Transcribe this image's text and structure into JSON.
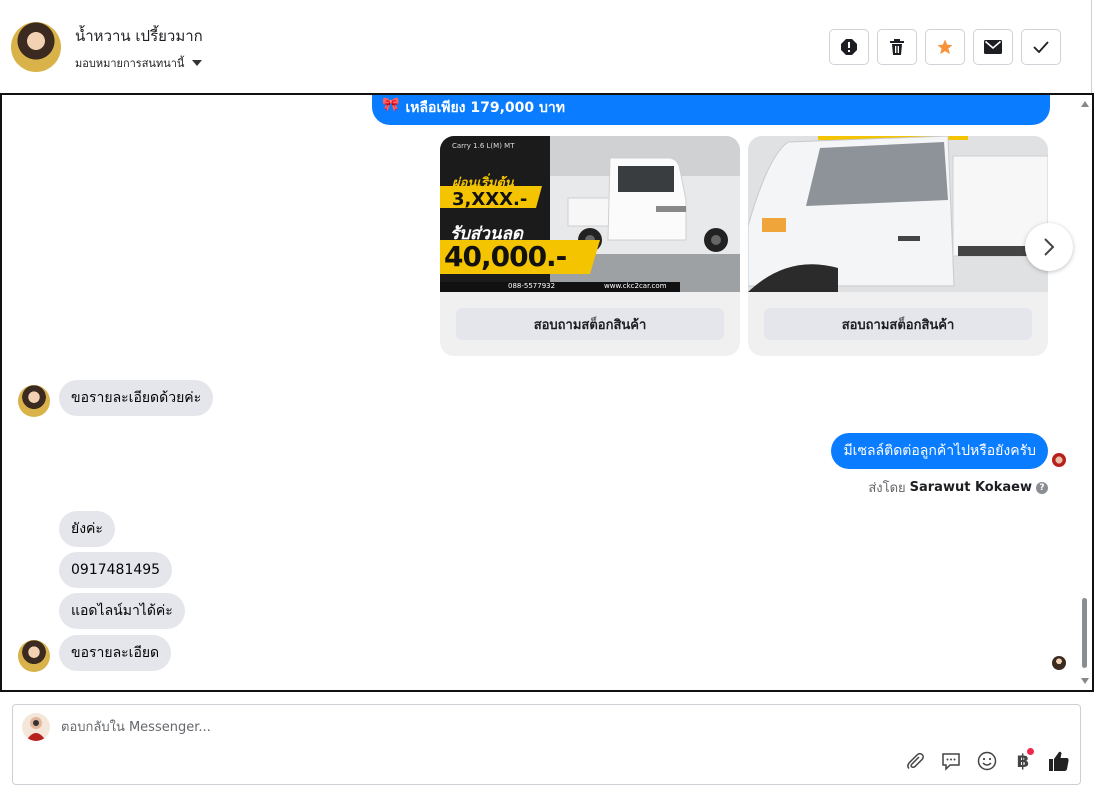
{
  "header": {
    "contact_name": "น้ำหวาน เปรี้ยวมาก",
    "assign_label": "มอบหมายการสนทนานี้",
    "actions": [
      {
        "name": "spam-icon"
      },
      {
        "name": "trash-icon"
      },
      {
        "name": "star-icon"
      },
      {
        "name": "mail-icon"
      },
      {
        "name": "check-icon"
      }
    ]
  },
  "promo": {
    "icon": "🎀",
    "text": "เหลือเพียง 179,000 บาท"
  },
  "cards": [
    {
      "button_label": "สอบถามสต็อกสินค้า",
      "overlay": {
        "line1": "ผ่อนเริ่มต้น",
        "line2": "3,XXX.-",
        "line3": "รับส่วนลด",
        "line4": "40,000.-",
        "phone": "088-5577932",
        "site": "www.ckc2car.com",
        "model": "Carry 1.6 L(M) MT"
      }
    },
    {
      "button_label": "สอบถามสต็อกสินค้า"
    }
  ],
  "messages": {
    "in_1": "ขอรายละเอียดด้วยค่ะ",
    "out_1": "มีเซลล์ติดต่อลูกค้าไปหรือยังครับ",
    "sent_by_prefix": "ส่งโดย",
    "sent_by_name": "Sarawut Kokaew",
    "help_glyph": "?",
    "in_2": "ยังค่ะ",
    "in_3": "0917481495",
    "in_4": "แอดไลน์มาได้ค่ะ",
    "in_5": "ขอรายละเอียด"
  },
  "composer": {
    "placeholder": "ตอบกลับใน Messenger...",
    "baht_glyph": "฿"
  },
  "colors": {
    "messenger_blue": "#0a7cff",
    "bubble_gray": "#e4e6eb",
    "star_orange": "#f7923a"
  }
}
